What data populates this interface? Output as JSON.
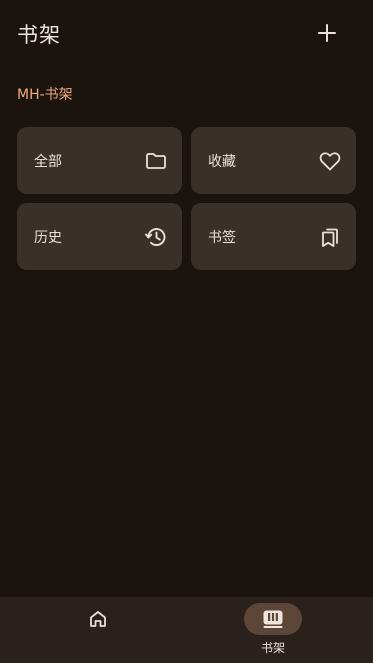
{
  "header": {
    "title": "书架",
    "add_icon": "plus-icon"
  },
  "section": {
    "label": "MH-书架"
  },
  "tiles": [
    {
      "label": "全部",
      "icon": "folder-icon"
    },
    {
      "label": "收藏",
      "icon": "heart-icon"
    },
    {
      "label": "历史",
      "icon": "history-icon"
    },
    {
      "label": "书签",
      "icon": "bookmarks-icon"
    }
  ],
  "bottom_nav": {
    "items": [
      {
        "label": "",
        "icon": "home-icon",
        "selected": false
      },
      {
        "label": "书架",
        "icon": "bookshelf-icon",
        "selected": true
      }
    ]
  },
  "colors": {
    "background": "#1b130e",
    "tile": "#3a302a",
    "accent": "#f0a97e",
    "nav_bg": "#2a211c",
    "nav_indicator": "#5b4637"
  }
}
